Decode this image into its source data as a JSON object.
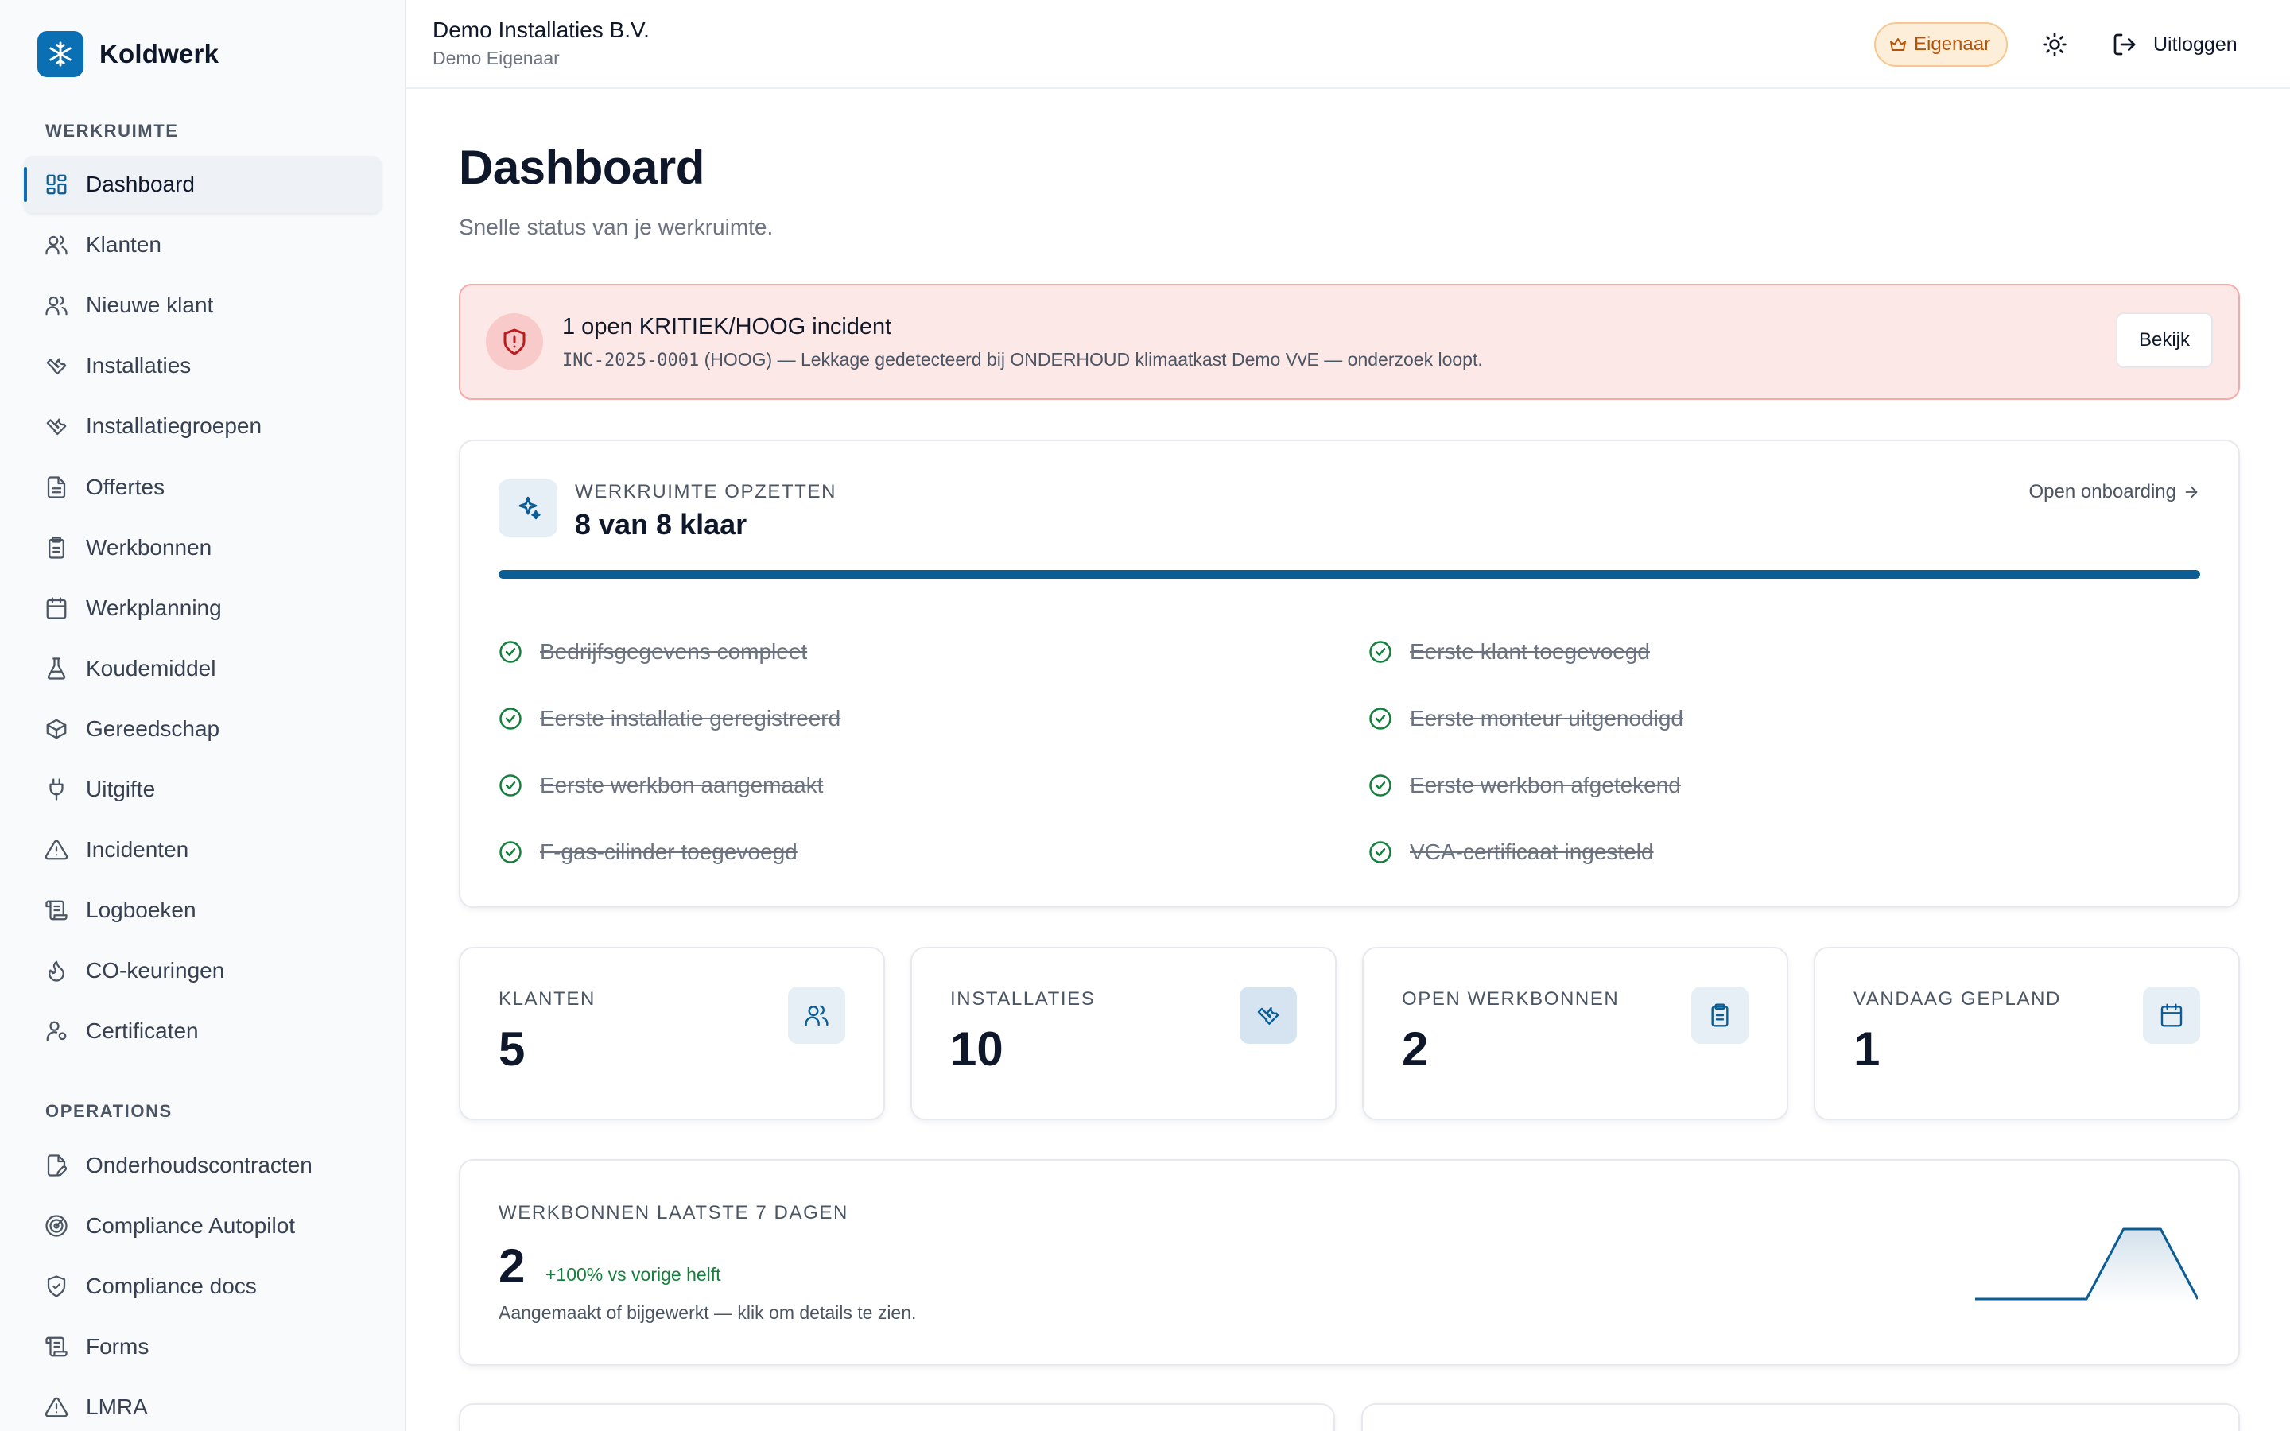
{
  "brand": {
    "name": "Koldwerk",
    "logo_icon": "snowflake-icon",
    "accent": "#0b6fb3"
  },
  "sidebar": {
    "sections": [
      {
        "label": "WERKRUIMTE",
        "items": [
          {
            "label": "Dashboard",
            "icon": "layout-grid-icon",
            "active": true
          },
          {
            "label": "Klanten",
            "icon": "users-icon"
          },
          {
            "label": "Nieuwe klant",
            "icon": "users-icon"
          },
          {
            "label": "Installaties",
            "icon": "wrench-icon"
          },
          {
            "label": "Installatiegroepen",
            "icon": "wrench-icon"
          },
          {
            "label": "Offertes",
            "icon": "file-text-icon"
          },
          {
            "label": "Werkbonnen",
            "icon": "clipboard-icon"
          },
          {
            "label": "Werkplanning",
            "icon": "calendar-icon"
          },
          {
            "label": "Koudemiddel",
            "icon": "flask-icon"
          },
          {
            "label": "Gereedschap",
            "icon": "box-icon"
          },
          {
            "label": "Uitgifte",
            "icon": "plug-icon"
          },
          {
            "label": "Incidenten",
            "icon": "alert-triangle-icon"
          },
          {
            "label": "Logboeken",
            "icon": "scroll-icon"
          },
          {
            "label": "CO-keuringen",
            "icon": "flame-icon"
          },
          {
            "label": "Certificaten",
            "icon": "user-cog-icon"
          }
        ]
      },
      {
        "label": "OPERATIONS",
        "items": [
          {
            "label": "Onderhoudscontracten",
            "icon": "file-pen-icon"
          },
          {
            "label": "Compliance Autopilot",
            "icon": "radar-icon"
          },
          {
            "label": "Compliance docs",
            "icon": "shield-check-icon"
          },
          {
            "label": "Forms",
            "icon": "scroll-icon"
          },
          {
            "label": "LMRA",
            "icon": "alert-triangle-icon"
          }
        ]
      }
    ]
  },
  "header": {
    "org_name": "Demo Installaties B.V.",
    "org_sub": "Demo Eigenaar",
    "role_badge": "Eigenaar",
    "role_icon": "crown-icon",
    "theme_icon": "sun-icon",
    "logout_label": "Uitloggen",
    "logout_icon": "log-out-icon"
  },
  "page": {
    "title": "Dashboard",
    "subtitle": "Snelle status van je werkruimte."
  },
  "alert": {
    "title": "1 open KRITIEK/HOOG incident",
    "code": "INC-2025-0001",
    "text": " (HOOG) — Lekkage gedetecteerd bij ONDERHOUD klimaatkast Demo VvE — onderzoek loopt.",
    "button": "Bekijk",
    "icon": "shield-alert-icon"
  },
  "setup": {
    "label": "WERKRUIMTE OPZETTEN",
    "progress_text": "8 van 8 klaar",
    "progress": 1.0,
    "link": "Open onboarding",
    "icon": "sparkles-icon",
    "left_items": [
      "Bedrijfsgegevens compleet",
      "Eerste installatie geregistreerd",
      "Eerste werkbon aangemaakt",
      "F-gas-cilinder toegevoegd"
    ],
    "right_items": [
      "Eerste klant toegevoegd",
      "Eerste monteur uitgenodigd",
      "Eerste werkbon afgetekend",
      "VCA-certificaat ingesteld"
    ]
  },
  "stats": [
    {
      "label": "KLANTEN",
      "value": "5",
      "icon": "users-icon"
    },
    {
      "label": "INSTALLATIES",
      "value": "10",
      "icon": "wrench-icon"
    },
    {
      "label": "OPEN WERKBONNEN",
      "value": "2",
      "icon": "clipboard-icon"
    },
    {
      "label": "VANDAAG GEPLAND",
      "value": "1",
      "icon": "calendar-icon"
    }
  ],
  "trend": {
    "label": "WERKBONNEN LAATSTE 7 DAGEN",
    "value": "2",
    "delta": "+100% vs vorige helft",
    "note": "Aangemaakt of bijgewerkt — klik om details te zien.",
    "sparkline": [
      0,
      0,
      0,
      0,
      1,
      1,
      0
    ]
  },
  "colors": {
    "accent": "#0b6fb3",
    "progress": "#0b5d96",
    "alert_bg": "#fde8e8",
    "alert_border": "#f5a9a9",
    "success": "#15803d",
    "badge_bg": "#fdeeda",
    "badge_text": "#b45309"
  }
}
